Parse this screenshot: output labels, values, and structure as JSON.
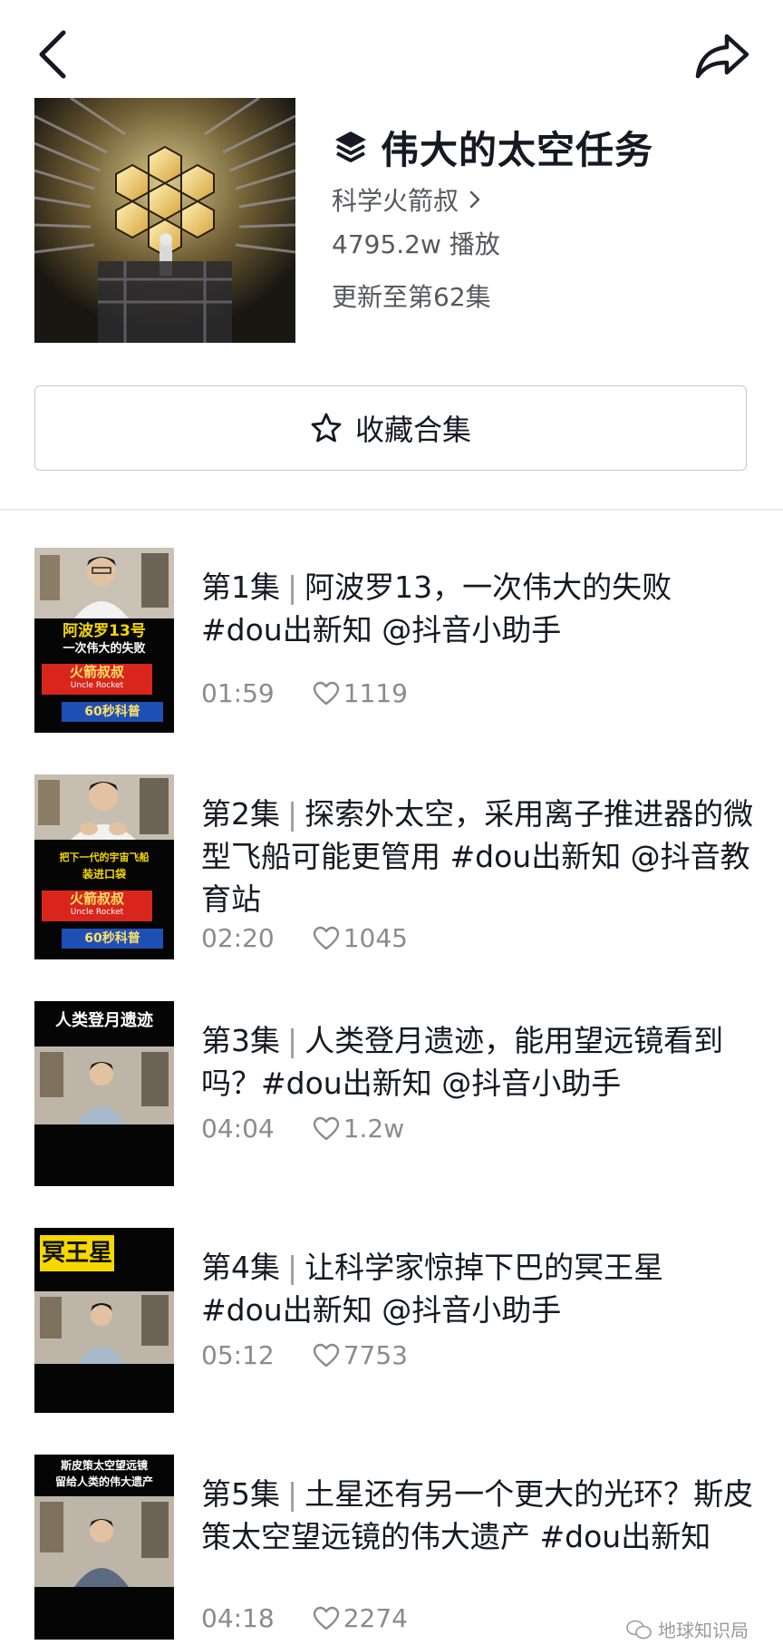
{
  "icons": {
    "back": "chevron-left-icon",
    "share": "share-arrow-icon",
    "collection": "layers-icon",
    "favorite": "star-outline-icon",
    "like": "heart-outline-icon",
    "author_arrow": "chevron-right-icon",
    "watermark": "wechat-icon"
  },
  "collection": {
    "title": "伟大的太空任务",
    "author": "科学火箭叔",
    "plays": "4795.2w 播放",
    "update": "更新至第62集",
    "favorite_label": "收藏合集"
  },
  "episodes": [
    {
      "label": "第1集",
      "title": "阿波罗13，一次伟大的失败 #dou出新知  @抖音小助手",
      "duration": "01:59",
      "likes": "1119",
      "thumb": {
        "line1": "阿波罗13号",
        "line2": "一次伟大的失败",
        "brand": "火箭叔叔",
        "brand_en": "Uncle Rocket",
        "tag": "60秒科普"
      }
    },
    {
      "label": "第2集",
      "title": "探索外太空，采用离子推进器的微型飞船可能更管用 #dou出新知  @抖音教育站",
      "duration": "02:20",
      "likes": "1045",
      "thumb": {
        "line1": "把下一代的宇宙飞船",
        "line2": "装进口袋",
        "brand": "火箭叔叔",
        "brand_en": "Uncle Rocket",
        "tag": "60秒科普"
      }
    },
    {
      "label": "第3集",
      "title": "人类登月遗迹，能用望远镜看到吗？#dou出新知 @抖音小助手",
      "duration": "04:04",
      "likes": "1.2w",
      "thumb": {
        "top_text": "人类登月遗迹"
      }
    },
    {
      "label": "第4集",
      "title": "让科学家惊掉下巴的冥王星 #dou出新知 @抖音小助手",
      "duration": "05:12",
      "likes": "7753",
      "thumb": {
        "top_text": "冥王星"
      }
    },
    {
      "label": "第5集",
      "title": "土星还有另一个更大的光环？斯皮策太空望远镜的伟大遗产 #dou出新知",
      "duration": "04:18",
      "likes": "2274",
      "thumb": {
        "top_text": "斯皮策太空望远镜",
        "top_text2": "留给人类的伟大遗产"
      }
    }
  ],
  "watermark": "地球知识局",
  "colors": {
    "text": "#161823",
    "secondary": "#57585e",
    "meta": "#8a8b91",
    "border": "#c9cacd",
    "thumb_red": "#d9261c",
    "thumb_blue": "#1e4fb4",
    "thumb_yellow": "#f5d800"
  }
}
